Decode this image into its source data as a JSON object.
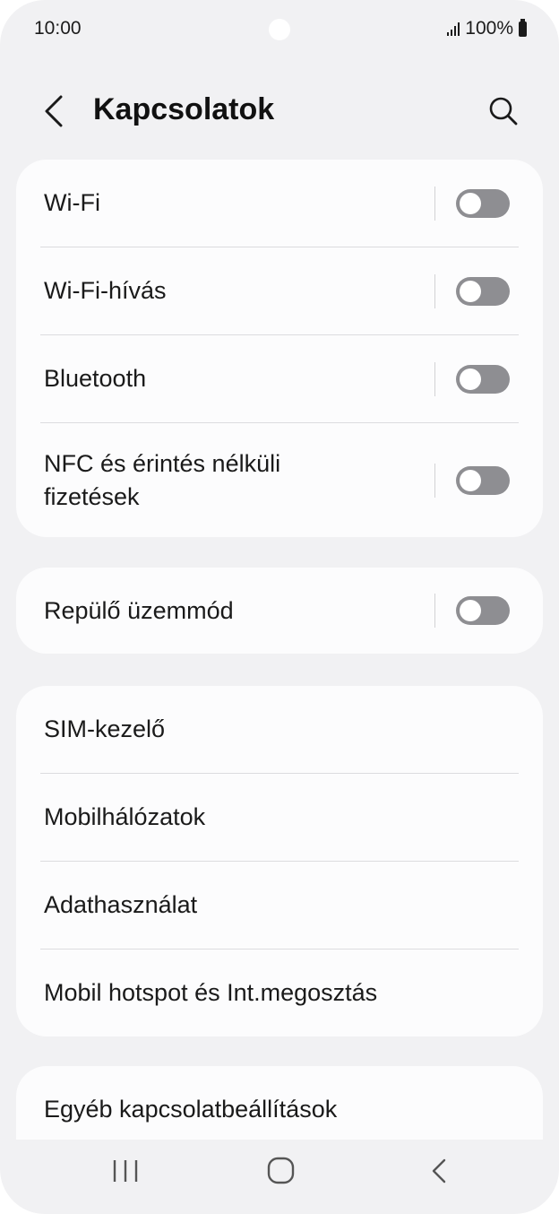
{
  "status_bar": {
    "time": "10:00",
    "battery": "100%"
  },
  "header": {
    "title": "Kapcsolatok"
  },
  "sections": [
    {
      "items": [
        {
          "label": "Wi-Fi",
          "toggle": false
        },
        {
          "label": "Wi-Fi-hívás",
          "toggle": false
        },
        {
          "label": "Bluetooth",
          "toggle": false
        },
        {
          "label": "NFC és érintés nélküli fizetések",
          "toggle": false
        }
      ]
    },
    {
      "items": [
        {
          "label": "Repülő üzemmód",
          "toggle": false
        }
      ]
    },
    {
      "items": [
        {
          "label": "SIM-kezelő"
        },
        {
          "label": "Mobilhálózatok"
        },
        {
          "label": "Adathasználat"
        },
        {
          "label": "Mobil hotspot és Int.megosztás"
        }
      ]
    },
    {
      "items": [
        {
          "label": "Egyéb kapcsolatbeállítások"
        }
      ]
    }
  ],
  "icons": {
    "back": "chevron-left-icon",
    "search": "search-icon",
    "nav_recents": "recents-icon",
    "nav_home": "home-icon",
    "nav_back": "back-icon"
  },
  "colors": {
    "background": "#f1f1f3",
    "card": "#fcfcfd",
    "toggle_off": "#8e8e92"
  }
}
